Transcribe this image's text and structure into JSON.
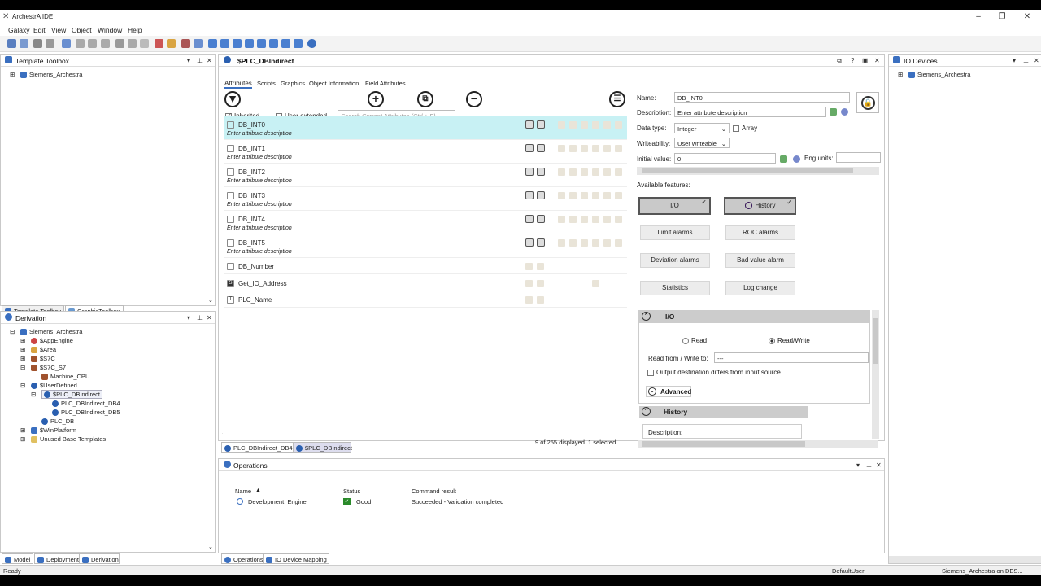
{
  "app": {
    "title": "ArchestrA IDE"
  },
  "menu": [
    "Galaxy",
    "Edit",
    "View",
    "Object",
    "Window",
    "Help"
  ],
  "template_toolbox": {
    "title": "Template Toolbox",
    "root": "Siemens_Archestra",
    "tabs": [
      "Template Toolbox",
      "GraphicToolbox"
    ]
  },
  "derivation": {
    "title": "Derivation",
    "items": [
      "Siemens_Archestra",
      "$AppEngine",
      "$Area",
      "$S7C",
      "$S7C_S7",
      "Machine_CPU",
      "$UserDefined",
      "$PLC_DBIndirect",
      "PLC_DBIndirect_DB4",
      "PLC_DBIndirect_DB5",
      "PLC_DB",
      "$WinPlatform",
      "Unused Base Templates"
    ],
    "tabs": [
      "Model",
      "Deployment",
      "Derivation"
    ]
  },
  "editor": {
    "title": "$PLC_DBIndirect",
    "tabs": [
      "Attributes",
      "Scripts",
      "Graphics",
      "Object Information",
      "Field Attributes"
    ],
    "inherited": "Inherited",
    "user_extended": "User extended",
    "search_placeholder": "Search Current Attributes (Ctrl + E)",
    "attributes": [
      {
        "name": "DB_INT0",
        "desc": "Enter attribute description"
      },
      {
        "name": "DB_INT1",
        "desc": "Enter attribute description"
      },
      {
        "name": "DB_INT2",
        "desc": "Enter attribute description"
      },
      {
        "name": "DB_INT3",
        "desc": "Enter attribute description"
      },
      {
        "name": "DB_INT4",
        "desc": "Enter attribute description"
      },
      {
        "name": "DB_INT5",
        "desc": "Enter attribute description"
      },
      {
        "name": "DB_Number",
        "desc": ""
      },
      {
        "name": "Get_IO_Address",
        "desc": ""
      },
      {
        "name": "PLC_Name",
        "desc": ""
      }
    ],
    "status": "9 of 255 displayed. 1 selected.",
    "doc_tabs": [
      "PLC_DBIndirect_DB4",
      "$PLC_DBIndirect"
    ]
  },
  "props": {
    "name_label": "Name:",
    "name_value": "DB_INT0",
    "desc_label": "Description:",
    "desc_value": "Enter attribute description",
    "type_label": "Data type:",
    "type_value": "Integer",
    "array_label": "Array",
    "write_label": "Writeability:",
    "write_value": "User writeable",
    "init_label": "Initial value:",
    "init_value": "0",
    "eng_label": "Eng units:",
    "features_label": "Available features:",
    "features": [
      "I/O",
      "History",
      "Limit alarms",
      "ROC alarms",
      "Deviation alarms",
      "Bad value alarm",
      "Statistics",
      "Log change"
    ],
    "io_section": "I/O",
    "read": "Read",
    "readwrite": "Read/Write",
    "read_from": "Read from / Write to:",
    "read_from_value": "---",
    "output_diff": "Output destination differs from input source",
    "advanced": "Advanced",
    "history_section": "History",
    "history_desc": "Description:"
  },
  "io_devices": {
    "title": "IO Devices",
    "root": "Siemens_Archestra"
  },
  "operations": {
    "title": "Operations",
    "cols": [
      "Name",
      "Status",
      "Command result"
    ],
    "rows": [
      {
        "name": "Development_Engine",
        "status": "Good",
        "result": "Succeeded - Validation completed"
      }
    ],
    "tabs": [
      "Operations",
      "IO Device Mapping"
    ]
  },
  "statusbar": {
    "left": "Ready",
    "user": "DefaultUser",
    "galaxy": "Siemens_Archestra on DES..."
  }
}
